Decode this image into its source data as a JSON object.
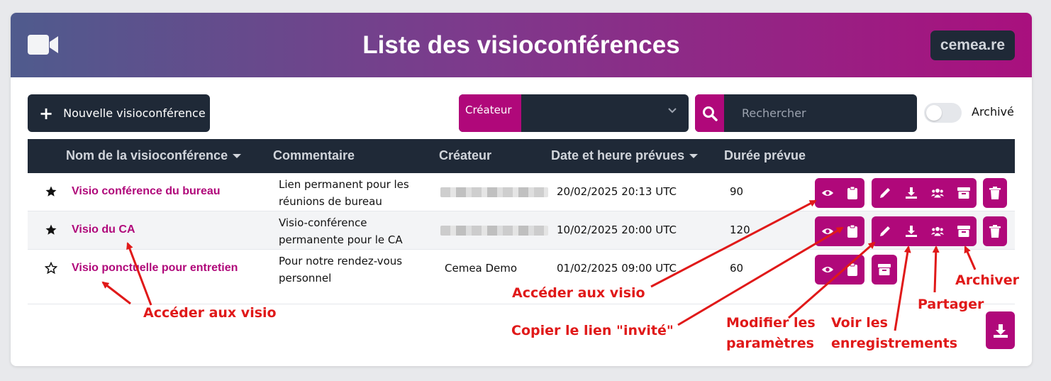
{
  "header": {
    "title": "Liste des visioconférences",
    "brand": "cemea.re",
    "icon": "video-camera-icon"
  },
  "toolbar": {
    "new_label": "Nouvelle visioconférence",
    "creator_filter_label": "Créateur",
    "creator_filter_value": "",
    "search_placeholder": "Rechercher",
    "archive_toggle_label": "Archivé",
    "archive_toggle_on": false
  },
  "table": {
    "columns": [
      "Nom de la visioconférence",
      "Commentaire",
      "Créateur",
      "Date et heure prévues",
      "Durée prévue"
    ],
    "sorted_columns": [
      "Nom de la visioconférence",
      "Date et heure prévues"
    ],
    "rows": [
      {
        "favorite": true,
        "name": "Visio conférence du bureau",
        "comment": "Lien permanent pour les réunions de bureau",
        "creator": "",
        "creator_redacted": true,
        "date": "20/02/2025 20:13 UTC",
        "duration": "90",
        "actions": [
          "eye-icon",
          "clipboard-icon",
          "pencil-icon",
          "download-icon",
          "users-icon",
          "archive-icon",
          "trash-icon"
        ]
      },
      {
        "favorite": true,
        "name": "Visio du CA",
        "comment": "Visio-conférence permanente pour le CA",
        "creator": "",
        "creator_redacted": true,
        "date": "10/02/2025 20:00 UTC",
        "duration": "120",
        "actions": [
          "eye-icon",
          "clipboard-icon",
          "pencil-icon",
          "download-icon",
          "users-icon",
          "archive-icon",
          "trash-icon"
        ]
      },
      {
        "favorite": false,
        "name": "Visio ponctuelle pour entretien",
        "comment": "Pour notre rendez-vous personnel",
        "creator": "Cemea Demo",
        "creator_redacted": false,
        "date": "01/02/2025 09:00 UTC",
        "duration": "60",
        "actions": [
          "eye-icon",
          "clipboard-icon",
          "archive-icon"
        ]
      }
    ]
  },
  "annotations": {
    "access_left": "Accéder aux visio",
    "access_right": "Accéder aux visio",
    "copy_guest_link": "Copier le lien \"invité\"",
    "modify_params_1": "Modifier les",
    "modify_params_2": "paramètres",
    "recordings_1": "Voir les",
    "recordings_2": "enregistrements",
    "share": "Partager",
    "archive": "Archiver"
  },
  "colors": {
    "accent": "#b0087a",
    "dark": "#1f2937",
    "annotation": "#e01919"
  }
}
